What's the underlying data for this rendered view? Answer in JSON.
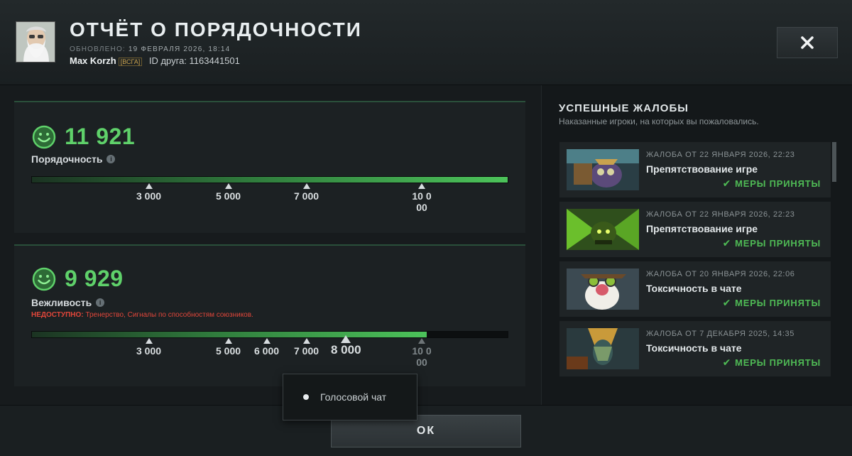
{
  "header": {
    "title": "ОТЧЁТ О ПОРЯДОЧНОСТИ",
    "updated_label": "ОБНОВЛЕНО:",
    "updated_date": "19 ФЕВРАЛЯ 2026, 18:14",
    "nickname": "Max Korzh",
    "tag": "[ВСГА]",
    "friend_id": "ID друга: 1163441501",
    "close_icon": "close-icon"
  },
  "behavior": {
    "score": "11 921",
    "label": "Порядочность",
    "progress": 1.0,
    "ticks": [
      "3 000",
      "5 000",
      "7 000",
      "10 000"
    ]
  },
  "communication": {
    "score": "9 929",
    "label": "Вежливость",
    "unavailable_prefix": "НЕДОСТУПНО:",
    "unavailable_text": " Тренерство, Сигналы по способностям союзников.",
    "progress": 0.83,
    "ticks": [
      "3 000",
      "5 000",
      "6 000",
      "7 000",
      "8 000",
      "10 000"
    ]
  },
  "tooltip": {
    "item": "Голосовой чат"
  },
  "reports": {
    "title": "УСПЕШНЫЕ ЖАЛОБЫ",
    "subtitle": "Наказанные игроки, на которых вы пожаловались.",
    "items": [
      {
        "date": "ЖАЛОБА ОТ 22 ЯНВАРЯ 2026, 22:23",
        "reason": "Препятствование игре",
        "status": "МЕРЫ ПРИНЯТЫ"
      },
      {
        "date": "ЖАЛОБА ОТ 22 ЯНВАРЯ 2026, 22:23",
        "reason": "Препятствование игре",
        "status": "МЕРЫ ПРИНЯТЫ"
      },
      {
        "date": "ЖАЛОБА ОТ 20 ЯНВАРЯ 2026, 22:06",
        "reason": "Токсичность в чате",
        "status": "МЕРЫ ПРИНЯТЫ"
      },
      {
        "date": "ЖАЛОБА ОТ 7 ДЕКАБРЯ 2025, 14:35",
        "reason": "Токсичность в чате",
        "status": "МЕРЫ ПРИНЯТЫ"
      }
    ]
  },
  "footer": {
    "ok_label": "ОК"
  },
  "colors": {
    "score_green": "#5fd16a",
    "status_green": "#4fbb55",
    "warning_red": "#e0463a"
  }
}
